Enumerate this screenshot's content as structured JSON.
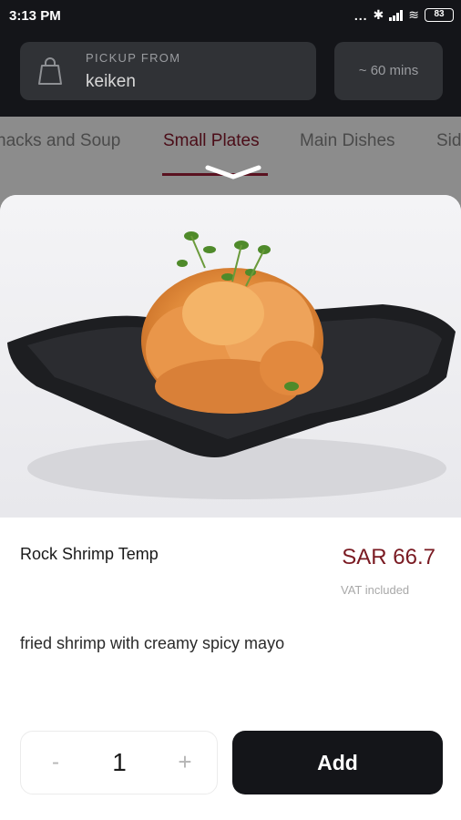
{
  "status_bar": {
    "time": "3:13 PM",
    "dots": "...",
    "bluetooth": "✱",
    "wifi": "≋",
    "battery": "83"
  },
  "pickup": {
    "label": "PICKUP FROM",
    "value": "keiken"
  },
  "eta": "~ 60 mins",
  "tabs": {
    "items": [
      "nacks and Soup",
      "Small Plates",
      "Main Dishes",
      "Sid"
    ],
    "active": "Small Plates"
  },
  "item": {
    "name": "Rock Shrimp Temp",
    "price": "SAR 66.7",
    "vat_note": "VAT included",
    "description": "fried shrimp with creamy spicy mayo"
  },
  "stepper": {
    "minus": "-",
    "quantity": "1",
    "plus": "+"
  },
  "add_button": "Add",
  "colors": {
    "header_bg": "#141519",
    "accent": "#7a1a22",
    "overlay": "#8c8c8c"
  }
}
